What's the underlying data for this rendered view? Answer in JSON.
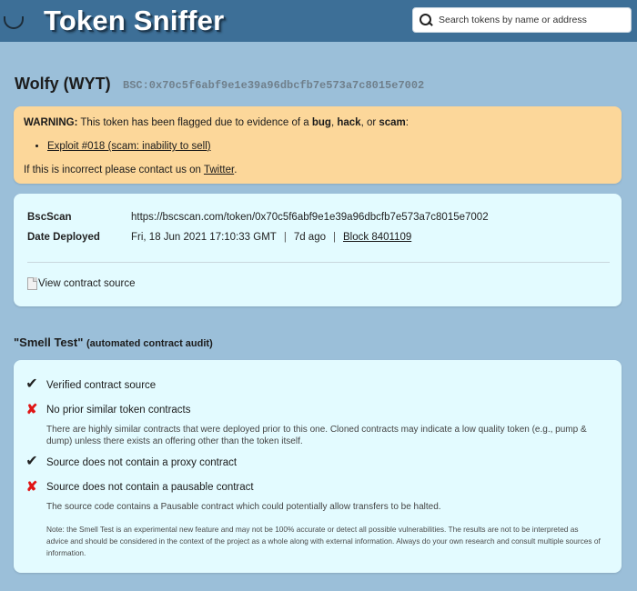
{
  "header": {
    "title": "Token Sniffer",
    "search_placeholder": "Search tokens by name or address"
  },
  "token": {
    "name": "Wolfy (WYT)",
    "address": "BSC:0x70c5f6abf9e1e39a96dbcfb7e573a7c8015e7002"
  },
  "warning": {
    "prefix": "WARNING:",
    "text1": " This token has been flagged due to evidence of a ",
    "bug": "bug",
    "comma": ", ",
    "hack": "hack",
    "or": ", or ",
    "scam": "scam",
    "colon": ":",
    "exploit_link": "Exploit #018 (scam: inability to sell)",
    "contact_prefix": "If this is incorrect please contact us on ",
    "contact_link": "Twitter",
    "contact_suffix": "."
  },
  "info": {
    "bscscan_label": "BscScan",
    "bscscan_url": "https://bscscan.com/token/0x70c5f6abf9e1e39a96dbcfb7e573a7c8015e7002",
    "deployed_label": "Date Deployed",
    "deployed_date": "Fri, 18 Jun 2021 17:10:33 GMT",
    "deployed_ago": "7d ago",
    "block_link": "Block 8401109",
    "view_source": "View contract source"
  },
  "smell_test": {
    "heading": "\"Smell Test\"",
    "subheading": "(automated contract audit)",
    "items": [
      {
        "status": "pass",
        "icon": "check-icon",
        "glyph": "✔",
        "title": "Verified contract source",
        "description": ""
      },
      {
        "status": "fail",
        "icon": "cross-icon",
        "glyph": "✘",
        "title": "No prior similar token contracts",
        "description": "There are highly similar contracts that were deployed prior to this one.  Cloned contracts may indicate a low quality token (e.g., pump & dump) unless there exists an offering other than the token itself."
      },
      {
        "status": "pass",
        "icon": "check-icon",
        "glyph": "✔",
        "title": "Source does not contain a proxy contract",
        "description": ""
      },
      {
        "status": "fail",
        "icon": "cross-icon",
        "glyph": "✘",
        "title": "Source does not contain a pausable contract",
        "description": "The source code contains a Pausable contract which could potentially allow transfers to be halted."
      }
    ],
    "note": "Note: the Smell Test is an experimental new feature and may not be 100% accurate or detect all possible vulnerabilities. The results are not to be interpreted as advice and should be considered in the context of the project as a whole along with external information. Always do your own research and consult multiple sources of information."
  },
  "colors": {
    "page_bg": "#9bbfd9",
    "header_bg": "#3d6f97",
    "warning_bg": "#fcd79a",
    "card_bg": "#e3fbff",
    "fail_red": "#e01515"
  }
}
